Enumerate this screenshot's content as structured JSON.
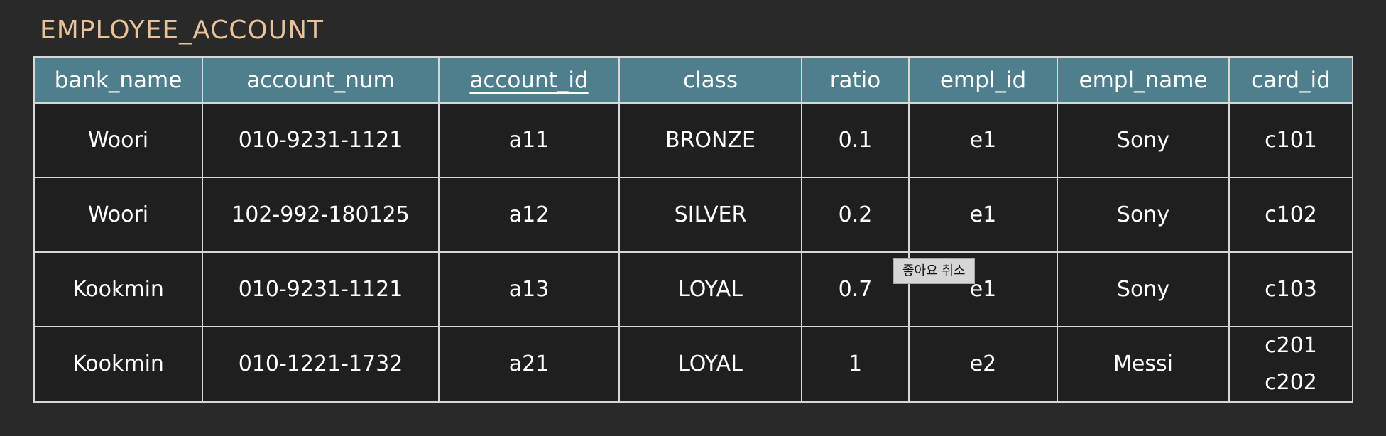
{
  "title": "EMPLOYEE_ACCOUNT",
  "columns": [
    {
      "label": "bank_name"
    },
    {
      "label": "account_num"
    },
    {
      "label": "account_id",
      "primary_key": true
    },
    {
      "label": "class"
    },
    {
      "label": "ratio"
    },
    {
      "label": "empl_id"
    },
    {
      "label": "empl_name"
    },
    {
      "label": "card_id"
    }
  ],
  "rows": [
    {
      "bank_name": "Woori",
      "account_num": "010-9231-1121",
      "account_id": "a11",
      "class": "BRONZE",
      "ratio": "0.1",
      "empl_id": "e1",
      "empl_name": "Sony",
      "card_id": [
        "c101"
      ]
    },
    {
      "bank_name": "Woori",
      "account_num": "102-992-180125",
      "account_id": "a12",
      "class": "SILVER",
      "ratio": "0.2",
      "empl_id": "e1",
      "empl_name": "Sony",
      "card_id": [
        "c102"
      ]
    },
    {
      "bank_name": "Kookmin",
      "account_num": "010-9231-1121",
      "account_id": "a13",
      "class": "LOYAL",
      "ratio": "0.7",
      "empl_id": "e1",
      "empl_name": "Sony",
      "card_id": [
        "c103"
      ]
    },
    {
      "bank_name": "Kookmin",
      "account_num": "010-1221-1732",
      "account_id": "a21",
      "class": "LOYAL",
      "ratio": "1",
      "empl_id": "e2",
      "empl_name": "Messi",
      "card_id": [
        "c201",
        "c202"
      ]
    }
  ],
  "tooltip": "좋아요 취소",
  "colors": {
    "background": "#2a292a",
    "title": "#e9c298",
    "header": "#4f7e8c",
    "cell": "#1f1f1f",
    "border": "#d7d7d7"
  }
}
